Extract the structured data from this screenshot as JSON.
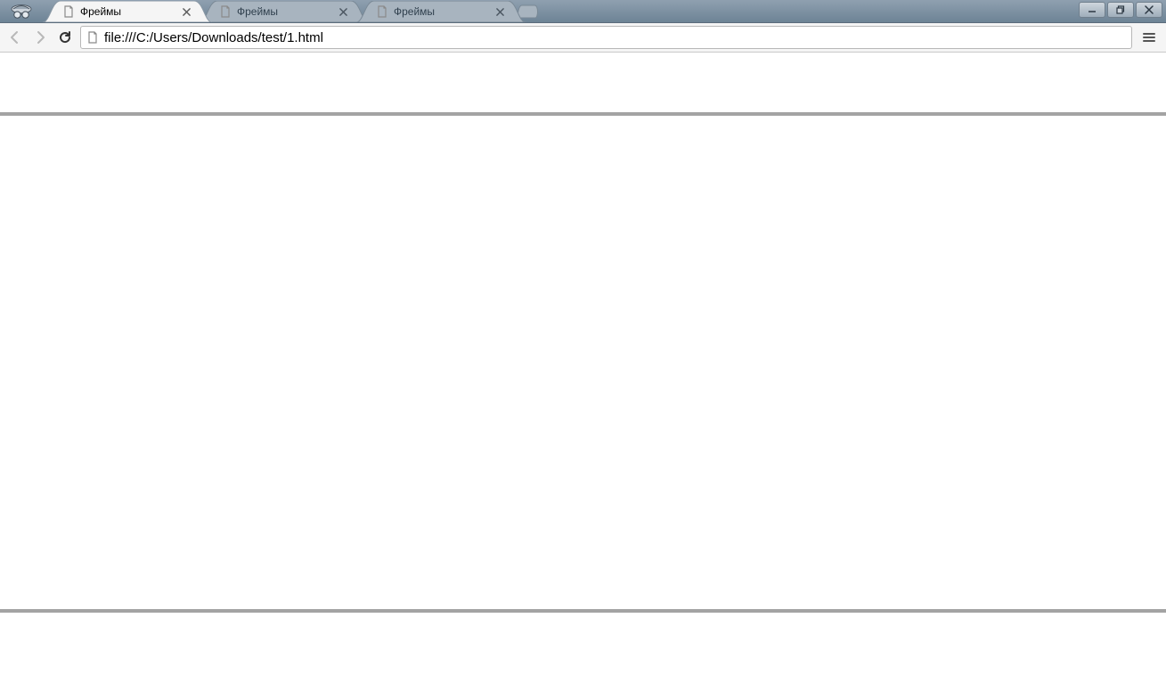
{
  "tabs": [
    {
      "title": "Фреймы",
      "active": true
    },
    {
      "title": "Фреймы",
      "active": false
    },
    {
      "title": "Фреймы",
      "active": false
    }
  ],
  "address": {
    "url": "file:///C:/Users/Downloads/test/1.html"
  }
}
